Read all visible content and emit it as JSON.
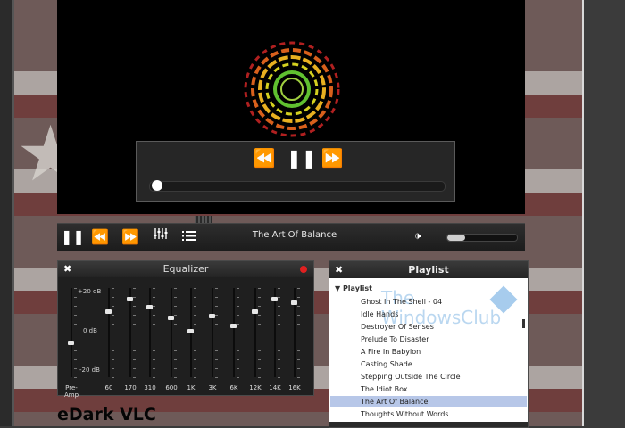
{
  "player": {
    "now_playing": "The Art Of Balance",
    "volume": 0.25,
    "seek_position": 0.0
  },
  "equalizer": {
    "title": "Equalizer",
    "scale": {
      "top": "+20 dB",
      "mid": "0 dB",
      "bottom": "-20 dB"
    },
    "bands": [
      {
        "label": "Pre-Amp",
        "level": 0.62
      },
      {
        "label": "60",
        "level": 0.25
      },
      {
        "label": "170",
        "level": 0.1
      },
      {
        "label": "310",
        "level": 0.2
      },
      {
        "label": "600",
        "level": 0.33
      },
      {
        "label": "1K",
        "level": 0.48
      },
      {
        "label": "3K",
        "level": 0.3
      },
      {
        "label": "6K",
        "level": 0.42
      },
      {
        "label": "12K",
        "level": 0.25
      },
      {
        "label": "14K",
        "level": 0.1
      },
      {
        "label": "16K",
        "level": 0.15
      }
    ]
  },
  "playlist": {
    "title": "Playlist",
    "root_label": "Playlist",
    "items": [
      {
        "label": "Ghost In The Shell - 04",
        "selected": false
      },
      {
        "label": "Idle Hands",
        "selected": false
      },
      {
        "label": "Destroyer Of Senses",
        "selected": false
      },
      {
        "label": "Prelude To Disaster",
        "selected": false
      },
      {
        "label": "A Fire In Babylon",
        "selected": false
      },
      {
        "label": "Casting Shade",
        "selected": false
      },
      {
        "label": "Stepping Outside The Circle",
        "selected": false
      },
      {
        "label": "The Idiot Box",
        "selected": false
      },
      {
        "label": "The Art Of Balance",
        "selected": true
      },
      {
        "label": "Thoughts Without Words",
        "selected": false
      }
    ],
    "watermark": "The WindowsClub"
  },
  "brand": "eDark VLC",
  "icons": {
    "play_pause": "pause-icon",
    "prev": "rewind-icon",
    "next": "fast-forward-icon",
    "equalizer": "equalizer-icon",
    "playlist": "playlist-icon",
    "volume": "volume-icon",
    "close": "close-icon"
  },
  "colors": {
    "accent": "#e02020",
    "selection": "#b7c7e8"
  }
}
